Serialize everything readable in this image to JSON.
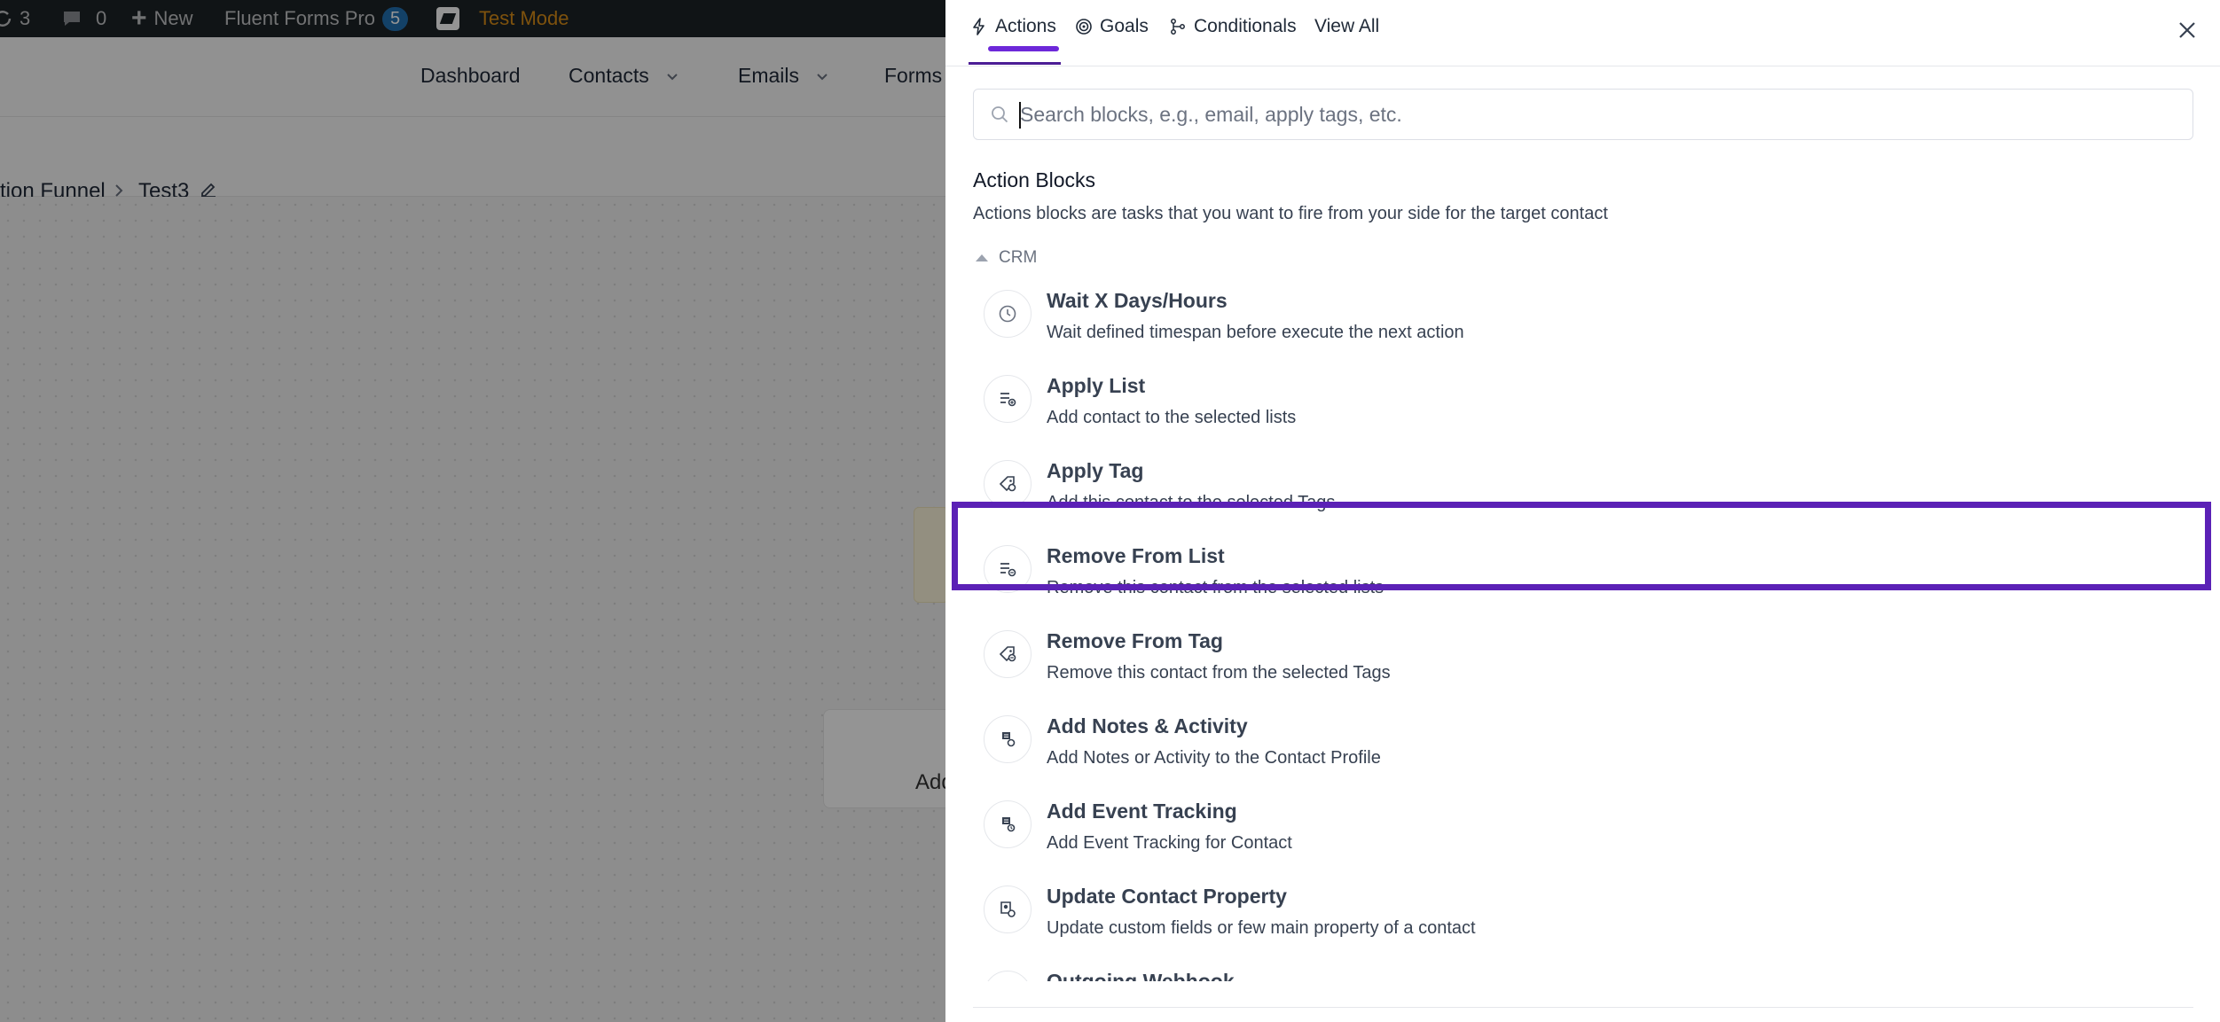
{
  "admin_bar": {
    "updates_count": "3",
    "comments_count": "0",
    "new_label": "New",
    "plugin_name": "Fluent Forms Pro",
    "plugin_badge": "5",
    "test_mode_label": "Test Mode"
  },
  "top_nav": {
    "items": [
      "Dashboard",
      "Contacts",
      "Emails",
      "Forms"
    ]
  },
  "breadcrumb": {
    "parent": "tion Funnel",
    "current": "Test3"
  },
  "canvas": {
    "ghost_label": "Add"
  },
  "drawer": {
    "tabs": [
      {
        "label": "Actions",
        "icon": "bolt-icon",
        "active": true
      },
      {
        "label": "Goals",
        "icon": "target-icon",
        "active": false
      },
      {
        "label": "Conditionals",
        "icon": "branch-icon",
        "active": false
      },
      {
        "label": "View All",
        "icon": "",
        "active": false
      }
    ],
    "search_placeholder": "Search blocks, e.g., email, apply tags, etc.",
    "section_title": "Action Blocks",
    "section_desc": "Actions blocks are tasks that you want to fire from your side for the target contact",
    "group_label": "CRM",
    "items": [
      {
        "title": "Wait X Days/Hours",
        "desc": "Wait defined timespan before execute the next action",
        "icon": "clock-icon"
      },
      {
        "title": "Apply List",
        "desc": "Add contact to the selected lists",
        "icon": "list-add-icon"
      },
      {
        "title": "Apply Tag",
        "desc": "Add this contact to the selected Tags",
        "icon": "tag-add-icon"
      },
      {
        "title": "Remove From List",
        "desc": "Remove this contact from the selected lists",
        "icon": "list-remove-icon"
      },
      {
        "title": "Remove From Tag",
        "desc": "Remove this contact from the selected Tags",
        "icon": "tag-remove-icon"
      },
      {
        "title": "Add Notes & Activity",
        "desc": "Add Notes or Activity to the Contact Profile",
        "icon": "note-icon"
      },
      {
        "title": "Add Event Tracking",
        "desc": "Add Event Tracking for Contact",
        "icon": "event-icon",
        "highlighted": true
      },
      {
        "title": "Update Contact Property",
        "desc": "Update custom fields or few main property of a contact",
        "icon": "contact-property-icon"
      },
      {
        "title": "Outgoing Webhook",
        "desc": "",
        "icon": "webhook-icon"
      }
    ]
  },
  "colors": {
    "accent": "#6d28d9",
    "highlight_border": "#5b21b6",
    "admin_bar": "#1d2327",
    "test_mode": "#d98d17"
  }
}
